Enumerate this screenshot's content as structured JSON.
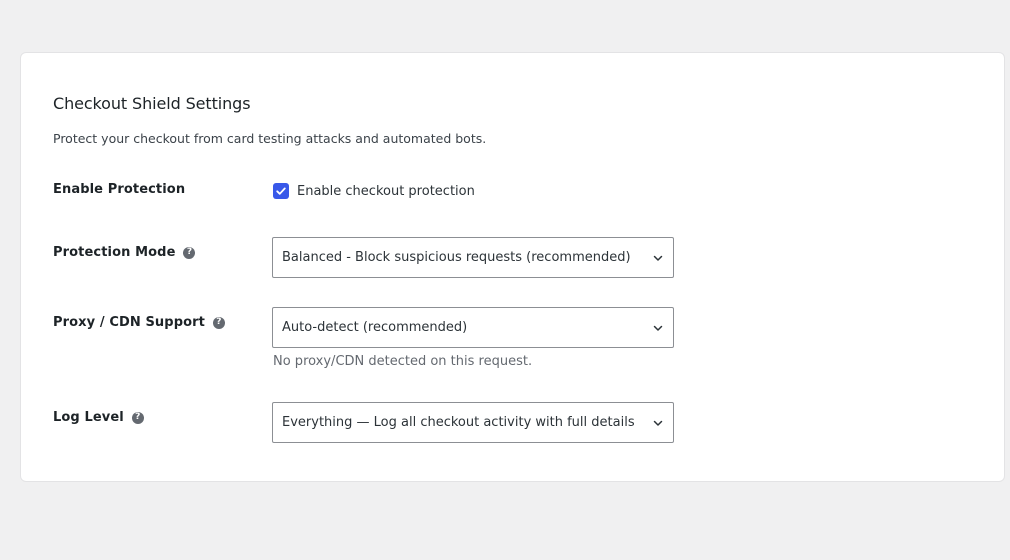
{
  "settings": {
    "title": "Checkout Shield Settings",
    "description": "Protect your checkout from card testing attacks and automated bots.",
    "enable_protection": {
      "label": "Enable Protection",
      "checkbox_label": "Enable checkout protection",
      "checked": true
    },
    "protection_mode": {
      "label": "Protection Mode",
      "selected": "Balanced - Block suspicious requests (recommended)"
    },
    "proxy_cdn": {
      "label": "Proxy / CDN Support",
      "selected": "Auto-detect (recommended)",
      "hint": "No proxy/CDN detected on this request."
    },
    "log_level": {
      "label": "Log Level",
      "selected": "Everything — Log all checkout activity with full details"
    }
  },
  "icons": {
    "help": "help-question-icon",
    "chevron": "chevron-down-icon",
    "check": "checkmark-icon"
  },
  "colors": {
    "accent": "#3858e9",
    "background": "#f0f0f1",
    "card": "#ffffff",
    "border": "#8c8f94"
  }
}
